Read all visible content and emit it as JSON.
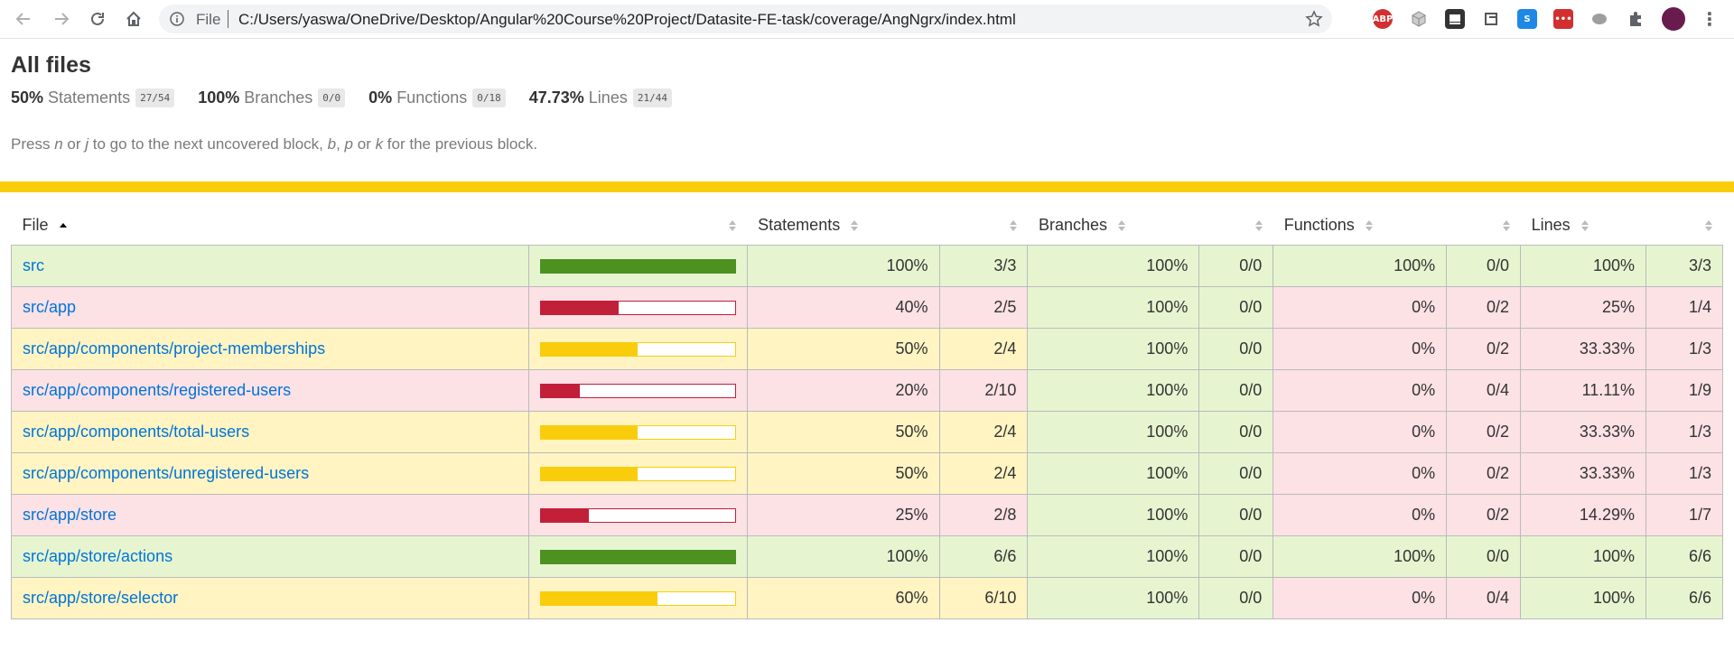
{
  "browser": {
    "scheme_label": "File",
    "url": "C:/Users/yaswa/OneDrive/Desktop/Angular%20Course%20Project/Datasite-FE-task/coverage/AngNgrx/index.html",
    "extensions": [
      "adblock-plus-icon",
      "3d-box-icon",
      "screen-icon",
      "tab-icon",
      "skype-icon",
      "dots-icon",
      "elephant-icon",
      "puzzle-icon",
      "profile-avatar"
    ]
  },
  "page": {
    "title": "All files",
    "summary": [
      {
        "pct": "50%",
        "label": "Statements",
        "fraction": "27/54"
      },
      {
        "pct": "100%",
        "label": "Branches",
        "fraction": "0/0"
      },
      {
        "pct": "0%",
        "label": "Functions",
        "fraction": "0/18"
      },
      {
        "pct": "47.73%",
        "label": "Lines",
        "fraction": "21/44"
      }
    ],
    "hint": {
      "p1": "Press ",
      "k1": "n",
      "p2": " or ",
      "k2": "j",
      "p3": " to go to the next uncovered block, ",
      "k3": "b",
      "p4": ", ",
      "k4": "p",
      "p5": " or ",
      "k5": "k",
      "p6": " for the previous block."
    },
    "status_color": "#f9cd0b"
  },
  "table": {
    "headers": {
      "file": "File",
      "statements": "Statements",
      "branches": "Branches",
      "functions": "Functions",
      "lines": "Lines"
    },
    "rows": [
      {
        "file": "src",
        "level": "high",
        "bar": 1.0,
        "stmt_pct": "100%",
        "stmt_frac": "3/3",
        "stmt_level": "high",
        "br_pct": "100%",
        "br_frac": "0/0",
        "br_level": "high",
        "fn_pct": "100%",
        "fn_frac": "0/0",
        "fn_level": "high",
        "ln_pct": "100%",
        "ln_frac": "3/3",
        "ln_level": "high"
      },
      {
        "file": "src/app",
        "level": "low",
        "bar": 0.4,
        "stmt_pct": "40%",
        "stmt_frac": "2/5",
        "stmt_level": "low",
        "br_pct": "100%",
        "br_frac": "0/0",
        "br_level": "high",
        "fn_pct": "0%",
        "fn_frac": "0/2",
        "fn_level": "low",
        "ln_pct": "25%",
        "ln_frac": "1/4",
        "ln_level": "low"
      },
      {
        "file": "src/app/components/project-memberships",
        "level": "medium",
        "bar": 0.5,
        "stmt_pct": "50%",
        "stmt_frac": "2/4",
        "stmt_level": "medium",
        "br_pct": "100%",
        "br_frac": "0/0",
        "br_level": "high",
        "fn_pct": "0%",
        "fn_frac": "0/2",
        "fn_level": "low",
        "ln_pct": "33.33%",
        "ln_frac": "1/3",
        "ln_level": "low"
      },
      {
        "file": "src/app/components/registered-users",
        "level": "low",
        "bar": 0.2,
        "stmt_pct": "20%",
        "stmt_frac": "2/10",
        "stmt_level": "low",
        "br_pct": "100%",
        "br_frac": "0/0",
        "br_level": "high",
        "fn_pct": "0%",
        "fn_frac": "0/4",
        "fn_level": "low",
        "ln_pct": "11.11%",
        "ln_frac": "1/9",
        "ln_level": "low"
      },
      {
        "file": "src/app/components/total-users",
        "level": "medium",
        "bar": 0.5,
        "stmt_pct": "50%",
        "stmt_frac": "2/4",
        "stmt_level": "medium",
        "br_pct": "100%",
        "br_frac": "0/0",
        "br_level": "high",
        "fn_pct": "0%",
        "fn_frac": "0/2",
        "fn_level": "low",
        "ln_pct": "33.33%",
        "ln_frac": "1/3",
        "ln_level": "low"
      },
      {
        "file": "src/app/components/unregistered-users",
        "level": "medium",
        "bar": 0.5,
        "stmt_pct": "50%",
        "stmt_frac": "2/4",
        "stmt_level": "medium",
        "br_pct": "100%",
        "br_frac": "0/0",
        "br_level": "high",
        "fn_pct": "0%",
        "fn_frac": "0/2",
        "fn_level": "low",
        "ln_pct": "33.33%",
        "ln_frac": "1/3",
        "ln_level": "low"
      },
      {
        "file": "src/app/store",
        "level": "low",
        "bar": 0.25,
        "stmt_pct": "25%",
        "stmt_frac": "2/8",
        "stmt_level": "low",
        "br_pct": "100%",
        "br_frac": "0/0",
        "br_level": "high",
        "fn_pct": "0%",
        "fn_frac": "0/2",
        "fn_level": "low",
        "ln_pct": "14.29%",
        "ln_frac": "1/7",
        "ln_level": "low"
      },
      {
        "file": "src/app/store/actions",
        "level": "high",
        "bar": 1.0,
        "stmt_pct": "100%",
        "stmt_frac": "6/6",
        "stmt_level": "high",
        "br_pct": "100%",
        "br_frac": "0/0",
        "br_level": "high",
        "fn_pct": "100%",
        "fn_frac": "0/0",
        "fn_level": "high",
        "ln_pct": "100%",
        "ln_frac": "6/6",
        "ln_level": "high"
      },
      {
        "file": "src/app/store/selector",
        "level": "medium",
        "bar": 0.6,
        "stmt_pct": "60%",
        "stmt_frac": "6/10",
        "stmt_level": "medium",
        "br_pct": "100%",
        "br_frac": "0/0",
        "br_level": "high",
        "fn_pct": "0%",
        "fn_frac": "0/4",
        "fn_level": "low",
        "ln_pct": "100%",
        "ln_frac": "6/6",
        "ln_level": "high"
      }
    ]
  }
}
